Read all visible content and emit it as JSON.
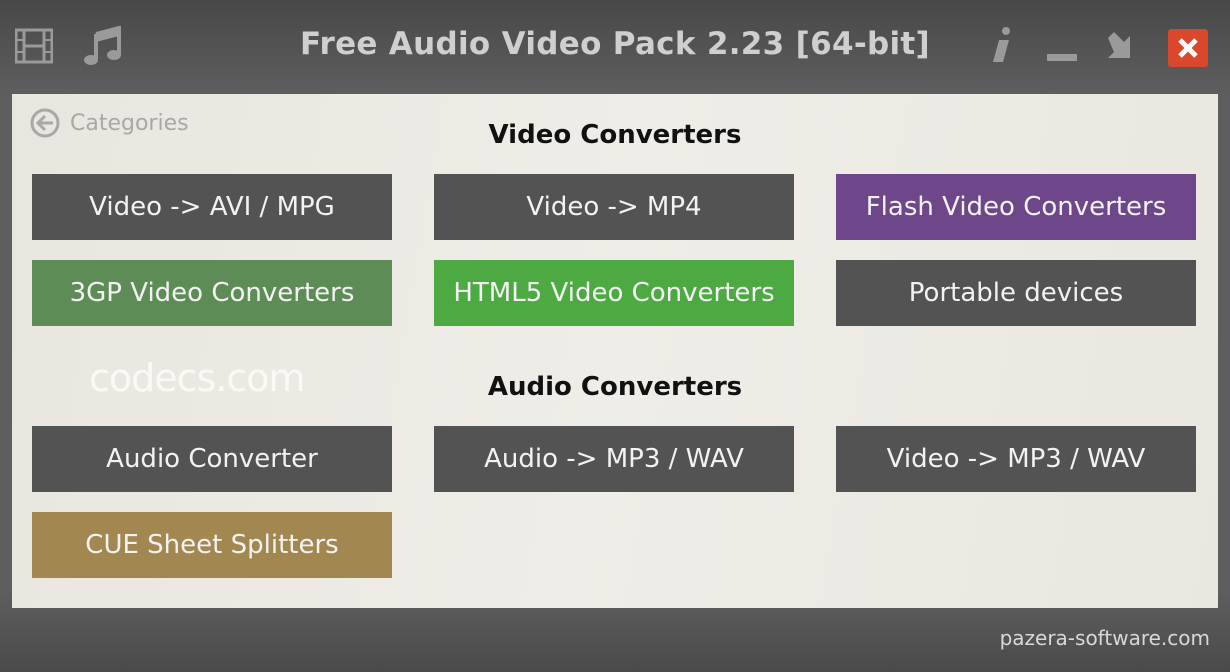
{
  "window": {
    "title": "Free Audio Video Pack 2.23 [64-bit]",
    "titlebar_icons": [
      "film-icon",
      "music-note-icon"
    ],
    "controls": [
      "info-icon",
      "minimize-icon",
      "restore-icon",
      "close-icon"
    ],
    "close_color": "#d9482c"
  },
  "nav": {
    "back_label": "Categories"
  },
  "sections": {
    "video": {
      "heading": "Video Converters",
      "buttons": [
        {
          "label": "Video -> AVI / MPG",
          "color": "#535353"
        },
        {
          "label": "Video -> MP4",
          "color": "#535353"
        },
        {
          "label": "Flash Video Converters",
          "color": "#6e478b"
        },
        {
          "label": "3GP Video Converters",
          "color": "#5e8c56"
        },
        {
          "label": "HTML5 Video Converters",
          "color": "#4daa43"
        },
        {
          "label": "Portable devices",
          "color": "#535353"
        }
      ]
    },
    "audio": {
      "heading": "Audio Converters",
      "buttons": [
        {
          "label": "Audio Converter",
          "color": "#535353"
        },
        {
          "label": "Audio -> MP3 / WAV",
          "color": "#535353"
        },
        {
          "label": "Video -> MP3 / WAV",
          "color": "#535353"
        },
        {
          "label": "CUE Sheet Splitters",
          "color": "#a38751"
        }
      ]
    }
  },
  "watermark": "codecs.com",
  "footer": {
    "link": "pazera-software.com"
  }
}
